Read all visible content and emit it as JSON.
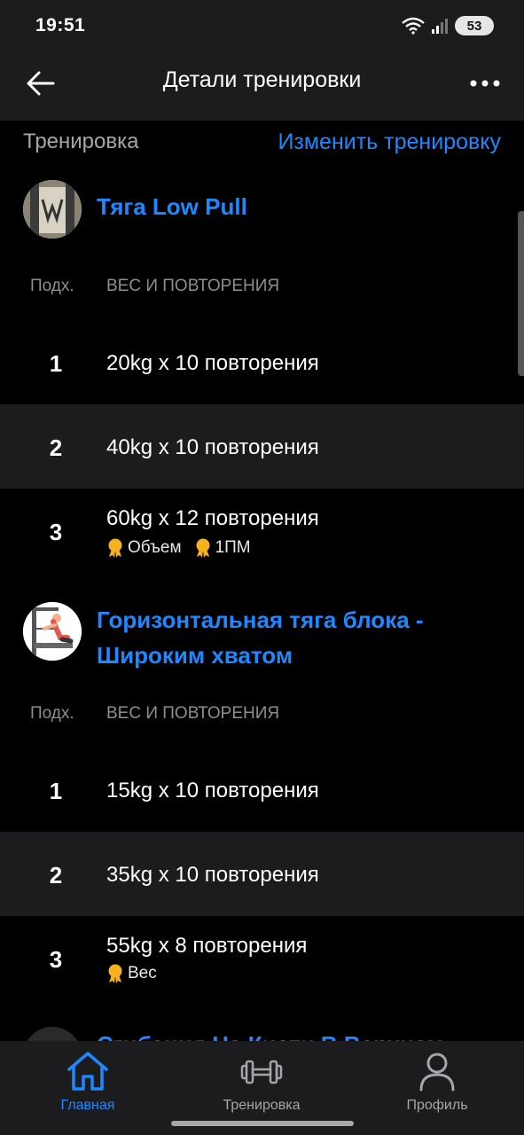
{
  "status": {
    "time": "19:51",
    "battery": "53"
  },
  "header": {
    "title": "Детали тренировки"
  },
  "section": {
    "label": "Тренировка",
    "edit_link": "Изменить тренировку"
  },
  "columns": {
    "set": "Подх.",
    "weight_reps": "ВЕС И ПОВТОРЕНИЯ"
  },
  "exercises": [
    {
      "name": "Тяга Low Pull",
      "sets": [
        {
          "num": "1",
          "value": "20kg x 10 повторения",
          "badges": []
        },
        {
          "num": "2",
          "value": "40kg x 10 повторения",
          "badges": []
        },
        {
          "num": "3",
          "value": "60kg x 12 повторения",
          "badges": [
            "Объем",
            "1ПМ"
          ]
        }
      ]
    },
    {
      "name": "Горизонтальная тяга блока - Широким хватом",
      "sets": [
        {
          "num": "1",
          "value": "15kg x 10 повторения",
          "badges": []
        },
        {
          "num": "2",
          "value": "35kg x 10 повторения",
          "badges": []
        },
        {
          "num": "3",
          "value": "55kg x 8 повторения",
          "badges": [
            "Вес"
          ]
        }
      ]
    },
    {
      "name": "Сгибания На Кисти В Верхнем"
    }
  ],
  "nav": [
    {
      "label": "Главная",
      "icon": "home-icon",
      "active": true
    },
    {
      "label": "Тренировка",
      "icon": "dumbbell-icon",
      "active": false
    },
    {
      "label": "Профиль",
      "icon": "profile-icon",
      "active": false
    }
  ],
  "colors": {
    "accent": "#1e88ff",
    "surface": "#1c1c1e",
    "background": "#000000",
    "badge": "#f5b21f"
  }
}
